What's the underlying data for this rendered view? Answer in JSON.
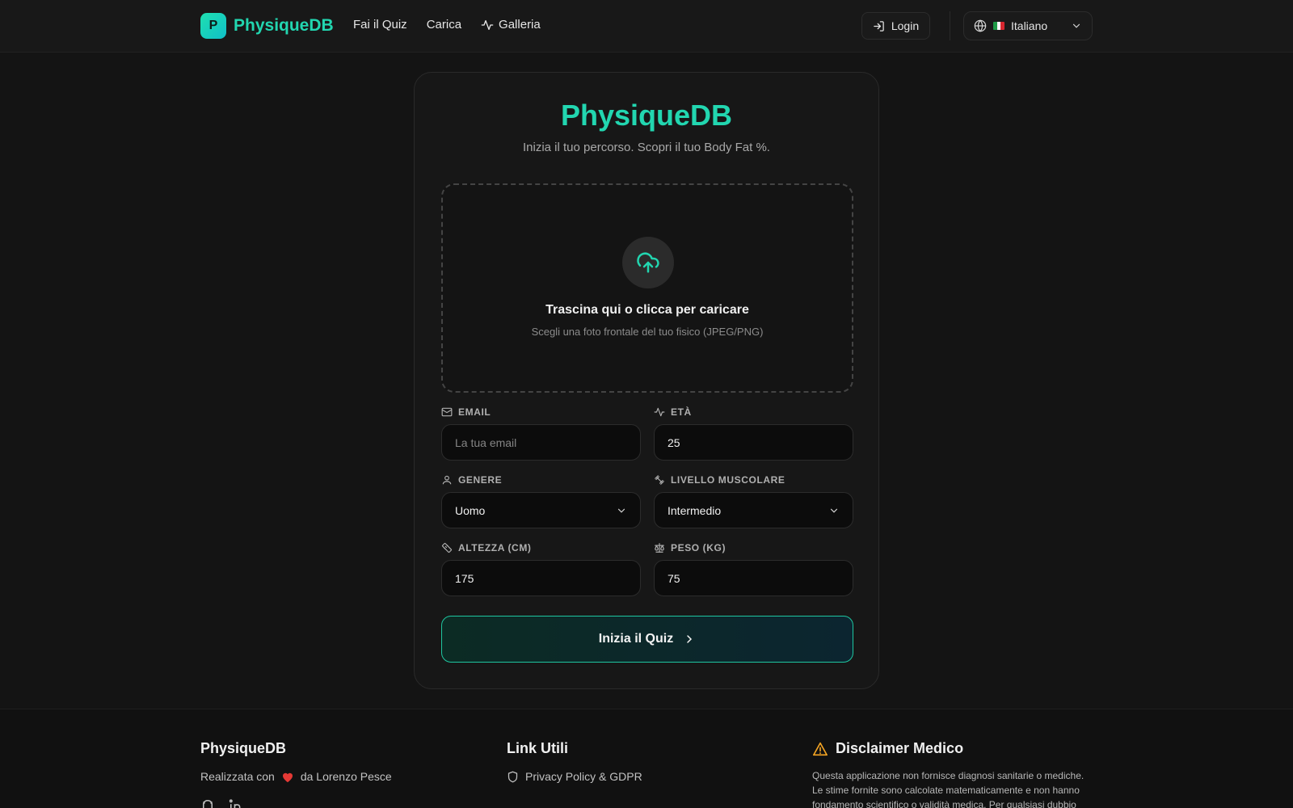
{
  "header": {
    "brand_letter": "P",
    "brand_name": "PhysiqueDB",
    "nav": [
      {
        "label": "Fai il Quiz"
      },
      {
        "label": "Carica"
      },
      {
        "label": "Galleria",
        "icon": "activity-icon"
      }
    ],
    "login_label": "Login",
    "language": {
      "label": "Italiano",
      "flag": "italy-flag",
      "icon": "globe-icon"
    }
  },
  "card": {
    "title": "PhysiqueDB",
    "subtitle": "Inizia il tuo percorso. Scopri il tuo Body Fat %.",
    "upload": {
      "icon": "cloud-upload-icon",
      "title": "Trascina qui o clicca per caricare",
      "hint": "Scegli una foto frontale del tuo fisico (JPEG/PNG)"
    },
    "fields": {
      "email": {
        "label": "EMAIL",
        "placeholder": "La tua email",
        "value": "",
        "icon": "mail-icon"
      },
      "age": {
        "label": "ETÀ",
        "value": "25",
        "icon": "activity-icon"
      },
      "gender": {
        "label": "GENERE",
        "value": "Uomo",
        "icon": "user-icon"
      },
      "muscle": {
        "label": "LIVELLO MUSCOLARE",
        "value": "Intermedio",
        "icon": "dumbbell-icon"
      },
      "height": {
        "label": "ALTEZZA (CM)",
        "value": "175",
        "icon": "ruler-icon"
      },
      "weight": {
        "label": "PESO (KG)",
        "value": "75",
        "icon": "scale-icon"
      }
    },
    "cta_label": "Inizia il Quiz"
  },
  "footer": {
    "brand": {
      "title": "PhysiqueDB",
      "made_prefix": "Realizzata con",
      "made_suffix": "da Lorenzo Pesce",
      "social_icons": [
        "github-icon",
        "linkedin-icon"
      ]
    },
    "links": {
      "title": "Link Utili",
      "privacy": "Privacy Policy & GDPR"
    },
    "disclaimer": {
      "title": "Disclaimer Medico",
      "text": "Questa applicazione non fornisce diagnosi sanitarie o mediche. Le stime fornite sono calcolate matematicamente e non hanno fondamento scientifico o validità medica. Per qualsiasi dubbio"
    }
  },
  "colors": {
    "accent": "#22d6b0",
    "background": "#141414",
    "warning": "#f5a524",
    "heart": "#e53935"
  }
}
